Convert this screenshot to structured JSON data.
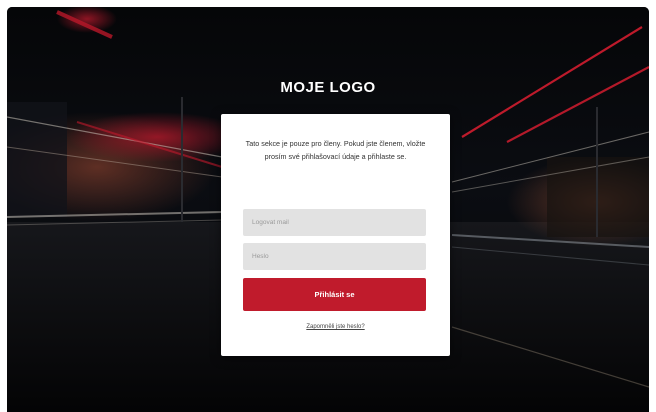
{
  "brand": {
    "logo_text": "MOJE LOGO"
  },
  "login": {
    "intro_text": "Tato sekce je pouze pro členy. Pokud jste členem, vložte prosím své přihlašovací údaje a přihlaste se.",
    "username_placeholder": "Logovat mail",
    "password_placeholder": "Heslo",
    "submit_label": "Přihlásit se",
    "forgot_link": "Zapomněli jste heslo?"
  },
  "colors": {
    "accent": "#c01b2c",
    "background": "#07080b",
    "card": "#ffffff",
    "field": "#e2e2e2"
  },
  "background_image": {
    "subject": "night street with red and white light trails"
  }
}
